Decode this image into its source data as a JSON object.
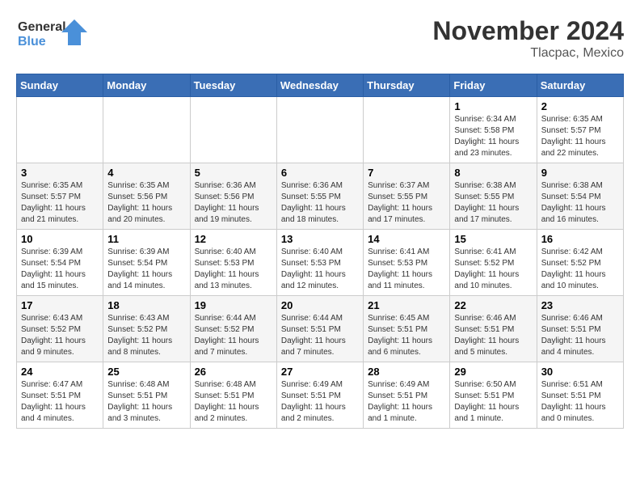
{
  "logo": {
    "text_general": "General",
    "text_blue": "Blue"
  },
  "title": "November 2024",
  "location": "Tlacpac, Mexico",
  "days_of_week": [
    "Sunday",
    "Monday",
    "Tuesday",
    "Wednesday",
    "Thursday",
    "Friday",
    "Saturday"
  ],
  "weeks": [
    [
      {
        "day": "",
        "info": ""
      },
      {
        "day": "",
        "info": ""
      },
      {
        "day": "",
        "info": ""
      },
      {
        "day": "",
        "info": ""
      },
      {
        "day": "",
        "info": ""
      },
      {
        "day": "1",
        "info": "Sunrise: 6:34 AM\nSunset: 5:58 PM\nDaylight: 11 hours and 23 minutes."
      },
      {
        "day": "2",
        "info": "Sunrise: 6:35 AM\nSunset: 5:57 PM\nDaylight: 11 hours and 22 minutes."
      }
    ],
    [
      {
        "day": "3",
        "info": "Sunrise: 6:35 AM\nSunset: 5:57 PM\nDaylight: 11 hours and 21 minutes."
      },
      {
        "day": "4",
        "info": "Sunrise: 6:35 AM\nSunset: 5:56 PM\nDaylight: 11 hours and 20 minutes."
      },
      {
        "day": "5",
        "info": "Sunrise: 6:36 AM\nSunset: 5:56 PM\nDaylight: 11 hours and 19 minutes."
      },
      {
        "day": "6",
        "info": "Sunrise: 6:36 AM\nSunset: 5:55 PM\nDaylight: 11 hours and 18 minutes."
      },
      {
        "day": "7",
        "info": "Sunrise: 6:37 AM\nSunset: 5:55 PM\nDaylight: 11 hours and 17 minutes."
      },
      {
        "day": "8",
        "info": "Sunrise: 6:38 AM\nSunset: 5:55 PM\nDaylight: 11 hours and 17 minutes."
      },
      {
        "day": "9",
        "info": "Sunrise: 6:38 AM\nSunset: 5:54 PM\nDaylight: 11 hours and 16 minutes."
      }
    ],
    [
      {
        "day": "10",
        "info": "Sunrise: 6:39 AM\nSunset: 5:54 PM\nDaylight: 11 hours and 15 minutes."
      },
      {
        "day": "11",
        "info": "Sunrise: 6:39 AM\nSunset: 5:54 PM\nDaylight: 11 hours and 14 minutes."
      },
      {
        "day": "12",
        "info": "Sunrise: 6:40 AM\nSunset: 5:53 PM\nDaylight: 11 hours and 13 minutes."
      },
      {
        "day": "13",
        "info": "Sunrise: 6:40 AM\nSunset: 5:53 PM\nDaylight: 11 hours and 12 minutes."
      },
      {
        "day": "14",
        "info": "Sunrise: 6:41 AM\nSunset: 5:53 PM\nDaylight: 11 hours and 11 minutes."
      },
      {
        "day": "15",
        "info": "Sunrise: 6:41 AM\nSunset: 5:52 PM\nDaylight: 11 hours and 10 minutes."
      },
      {
        "day": "16",
        "info": "Sunrise: 6:42 AM\nSunset: 5:52 PM\nDaylight: 11 hours and 10 minutes."
      }
    ],
    [
      {
        "day": "17",
        "info": "Sunrise: 6:43 AM\nSunset: 5:52 PM\nDaylight: 11 hours and 9 minutes."
      },
      {
        "day": "18",
        "info": "Sunrise: 6:43 AM\nSunset: 5:52 PM\nDaylight: 11 hours and 8 minutes."
      },
      {
        "day": "19",
        "info": "Sunrise: 6:44 AM\nSunset: 5:52 PM\nDaylight: 11 hours and 7 minutes."
      },
      {
        "day": "20",
        "info": "Sunrise: 6:44 AM\nSunset: 5:51 PM\nDaylight: 11 hours and 7 minutes."
      },
      {
        "day": "21",
        "info": "Sunrise: 6:45 AM\nSunset: 5:51 PM\nDaylight: 11 hours and 6 minutes."
      },
      {
        "day": "22",
        "info": "Sunrise: 6:46 AM\nSunset: 5:51 PM\nDaylight: 11 hours and 5 minutes."
      },
      {
        "day": "23",
        "info": "Sunrise: 6:46 AM\nSunset: 5:51 PM\nDaylight: 11 hours and 4 minutes."
      }
    ],
    [
      {
        "day": "24",
        "info": "Sunrise: 6:47 AM\nSunset: 5:51 PM\nDaylight: 11 hours and 4 minutes."
      },
      {
        "day": "25",
        "info": "Sunrise: 6:48 AM\nSunset: 5:51 PM\nDaylight: 11 hours and 3 minutes."
      },
      {
        "day": "26",
        "info": "Sunrise: 6:48 AM\nSunset: 5:51 PM\nDaylight: 11 hours and 2 minutes."
      },
      {
        "day": "27",
        "info": "Sunrise: 6:49 AM\nSunset: 5:51 PM\nDaylight: 11 hours and 2 minutes."
      },
      {
        "day": "28",
        "info": "Sunrise: 6:49 AM\nSunset: 5:51 PM\nDaylight: 11 hours and 1 minute."
      },
      {
        "day": "29",
        "info": "Sunrise: 6:50 AM\nSunset: 5:51 PM\nDaylight: 11 hours and 1 minute."
      },
      {
        "day": "30",
        "info": "Sunrise: 6:51 AM\nSunset: 5:51 PM\nDaylight: 11 hours and 0 minutes."
      }
    ]
  ]
}
